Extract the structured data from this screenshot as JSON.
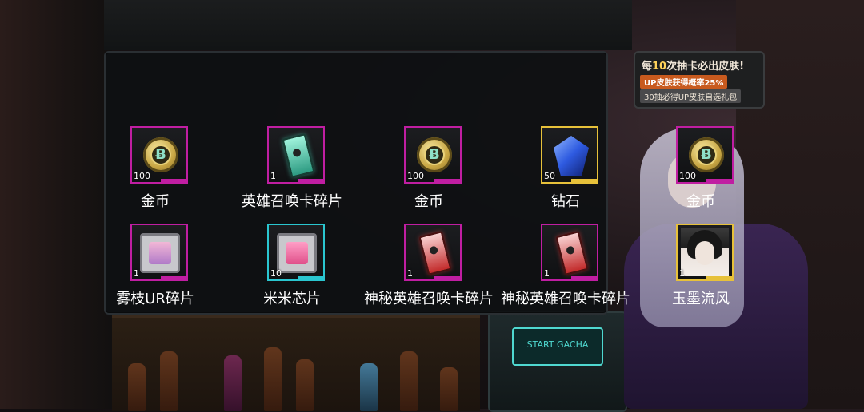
{
  "promo": {
    "line1_prefix": "每",
    "line1_count": "10",
    "line1_suffix": "次抽卡必出皮肤!",
    "line2": "UP皮肤获得概率25%",
    "line3": "30抽必得UP皮肤自选礼包"
  },
  "machine_label": "START GACHA",
  "rewards": [
    {
      "name": "金币",
      "qty": "100",
      "icon": "gold-coin-icon",
      "rarity": "purple"
    },
    {
      "name": "英雄召唤卡碎片",
      "qty": "1",
      "icon": "hero-summon-card-fragment-icon",
      "rarity": "purple"
    },
    {
      "name": "金币",
      "qty": "100",
      "icon": "gold-coin-icon",
      "rarity": "purple"
    },
    {
      "name": "钻石",
      "qty": "50",
      "icon": "diamond-icon",
      "rarity": "gold"
    },
    {
      "name": "金币",
      "qty": "100",
      "icon": "gold-coin-icon",
      "rarity": "purple"
    },
    {
      "name": "雾枝UR碎片",
      "qty": "1",
      "icon": "ur-fragment-chip-icon",
      "rarity": "purple"
    },
    {
      "name": "米米芯片",
      "qty": "10",
      "icon": "mimi-chip-icon",
      "rarity": "cyan"
    },
    {
      "name": "神秘英雄召唤卡碎片",
      "qty": "1",
      "icon": "mystery-summon-card-fragment-icon",
      "rarity": "purple"
    },
    {
      "name": "神秘英雄召唤卡碎片",
      "qty": "1",
      "icon": "mystery-summon-card-fragment-icon",
      "rarity": "purple"
    },
    {
      "name": "玉墨流风",
      "qty": "1",
      "icon": "character-portrait-icon",
      "rarity": "gold"
    }
  ],
  "colors": {
    "purple": "#c01ea2",
    "gold": "#e7c13a",
    "cyan": "#2ac6d0"
  }
}
